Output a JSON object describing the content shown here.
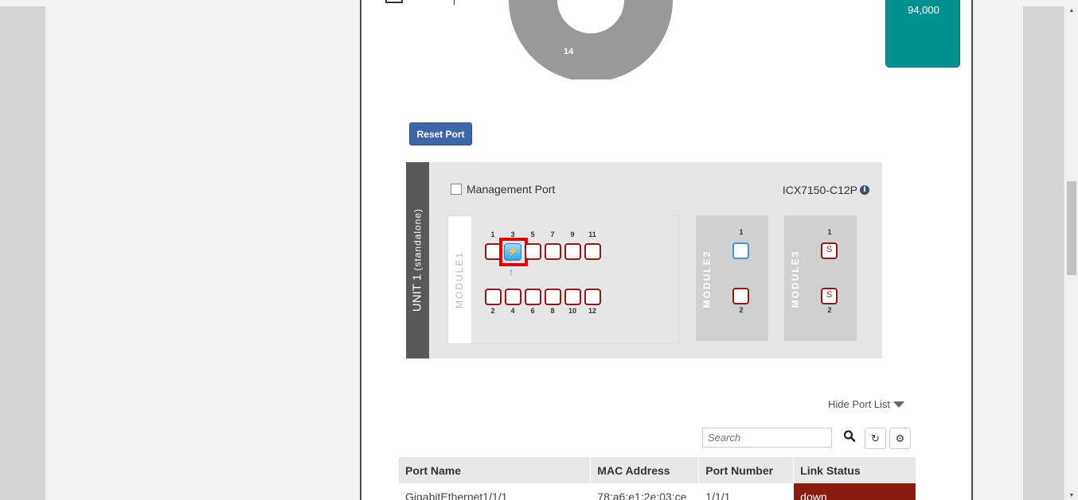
{
  "donut": {
    "label": "14"
  },
  "card": {
    "value": "94,000"
  },
  "reset_button": "Reset Port",
  "unit": {
    "title": "UNIT 1",
    "subtitle": "(standalone)"
  },
  "management_port_label": "Management Port",
  "model": {
    "name": "ICX7150-C12P",
    "info_icon": "info-circle-icon"
  },
  "module1": {
    "label": "MODULE1",
    "top_ports": [
      "1",
      "3",
      "5",
      "7",
      "9",
      "11"
    ],
    "bottom_ports": [
      "2",
      "4",
      "6",
      "8",
      "10",
      "12"
    ],
    "selected_port": "3"
  },
  "module2": {
    "label": "MODULE2",
    "ports": [
      "1",
      "2"
    ]
  },
  "module3": {
    "label": "MODULE3",
    "ports": [
      "1",
      "2"
    ],
    "port_text": "S"
  },
  "hide_port_list": "Hide Port List",
  "search": {
    "placeholder": "Search"
  },
  "table": {
    "headers": [
      "Port Name",
      "MAC Address",
      "Port Number",
      "Link Status"
    ],
    "rows": [
      [
        "GigabitEthernet1/1/1",
        "78:a6:e1:2e:03:ce",
        "1/1/1",
        "down"
      ]
    ]
  },
  "colors": {
    "teal": "#009090",
    "reset_blue": "#3f67a8",
    "port_border": "#8b1a1a",
    "down": "#8b1a0f"
  }
}
